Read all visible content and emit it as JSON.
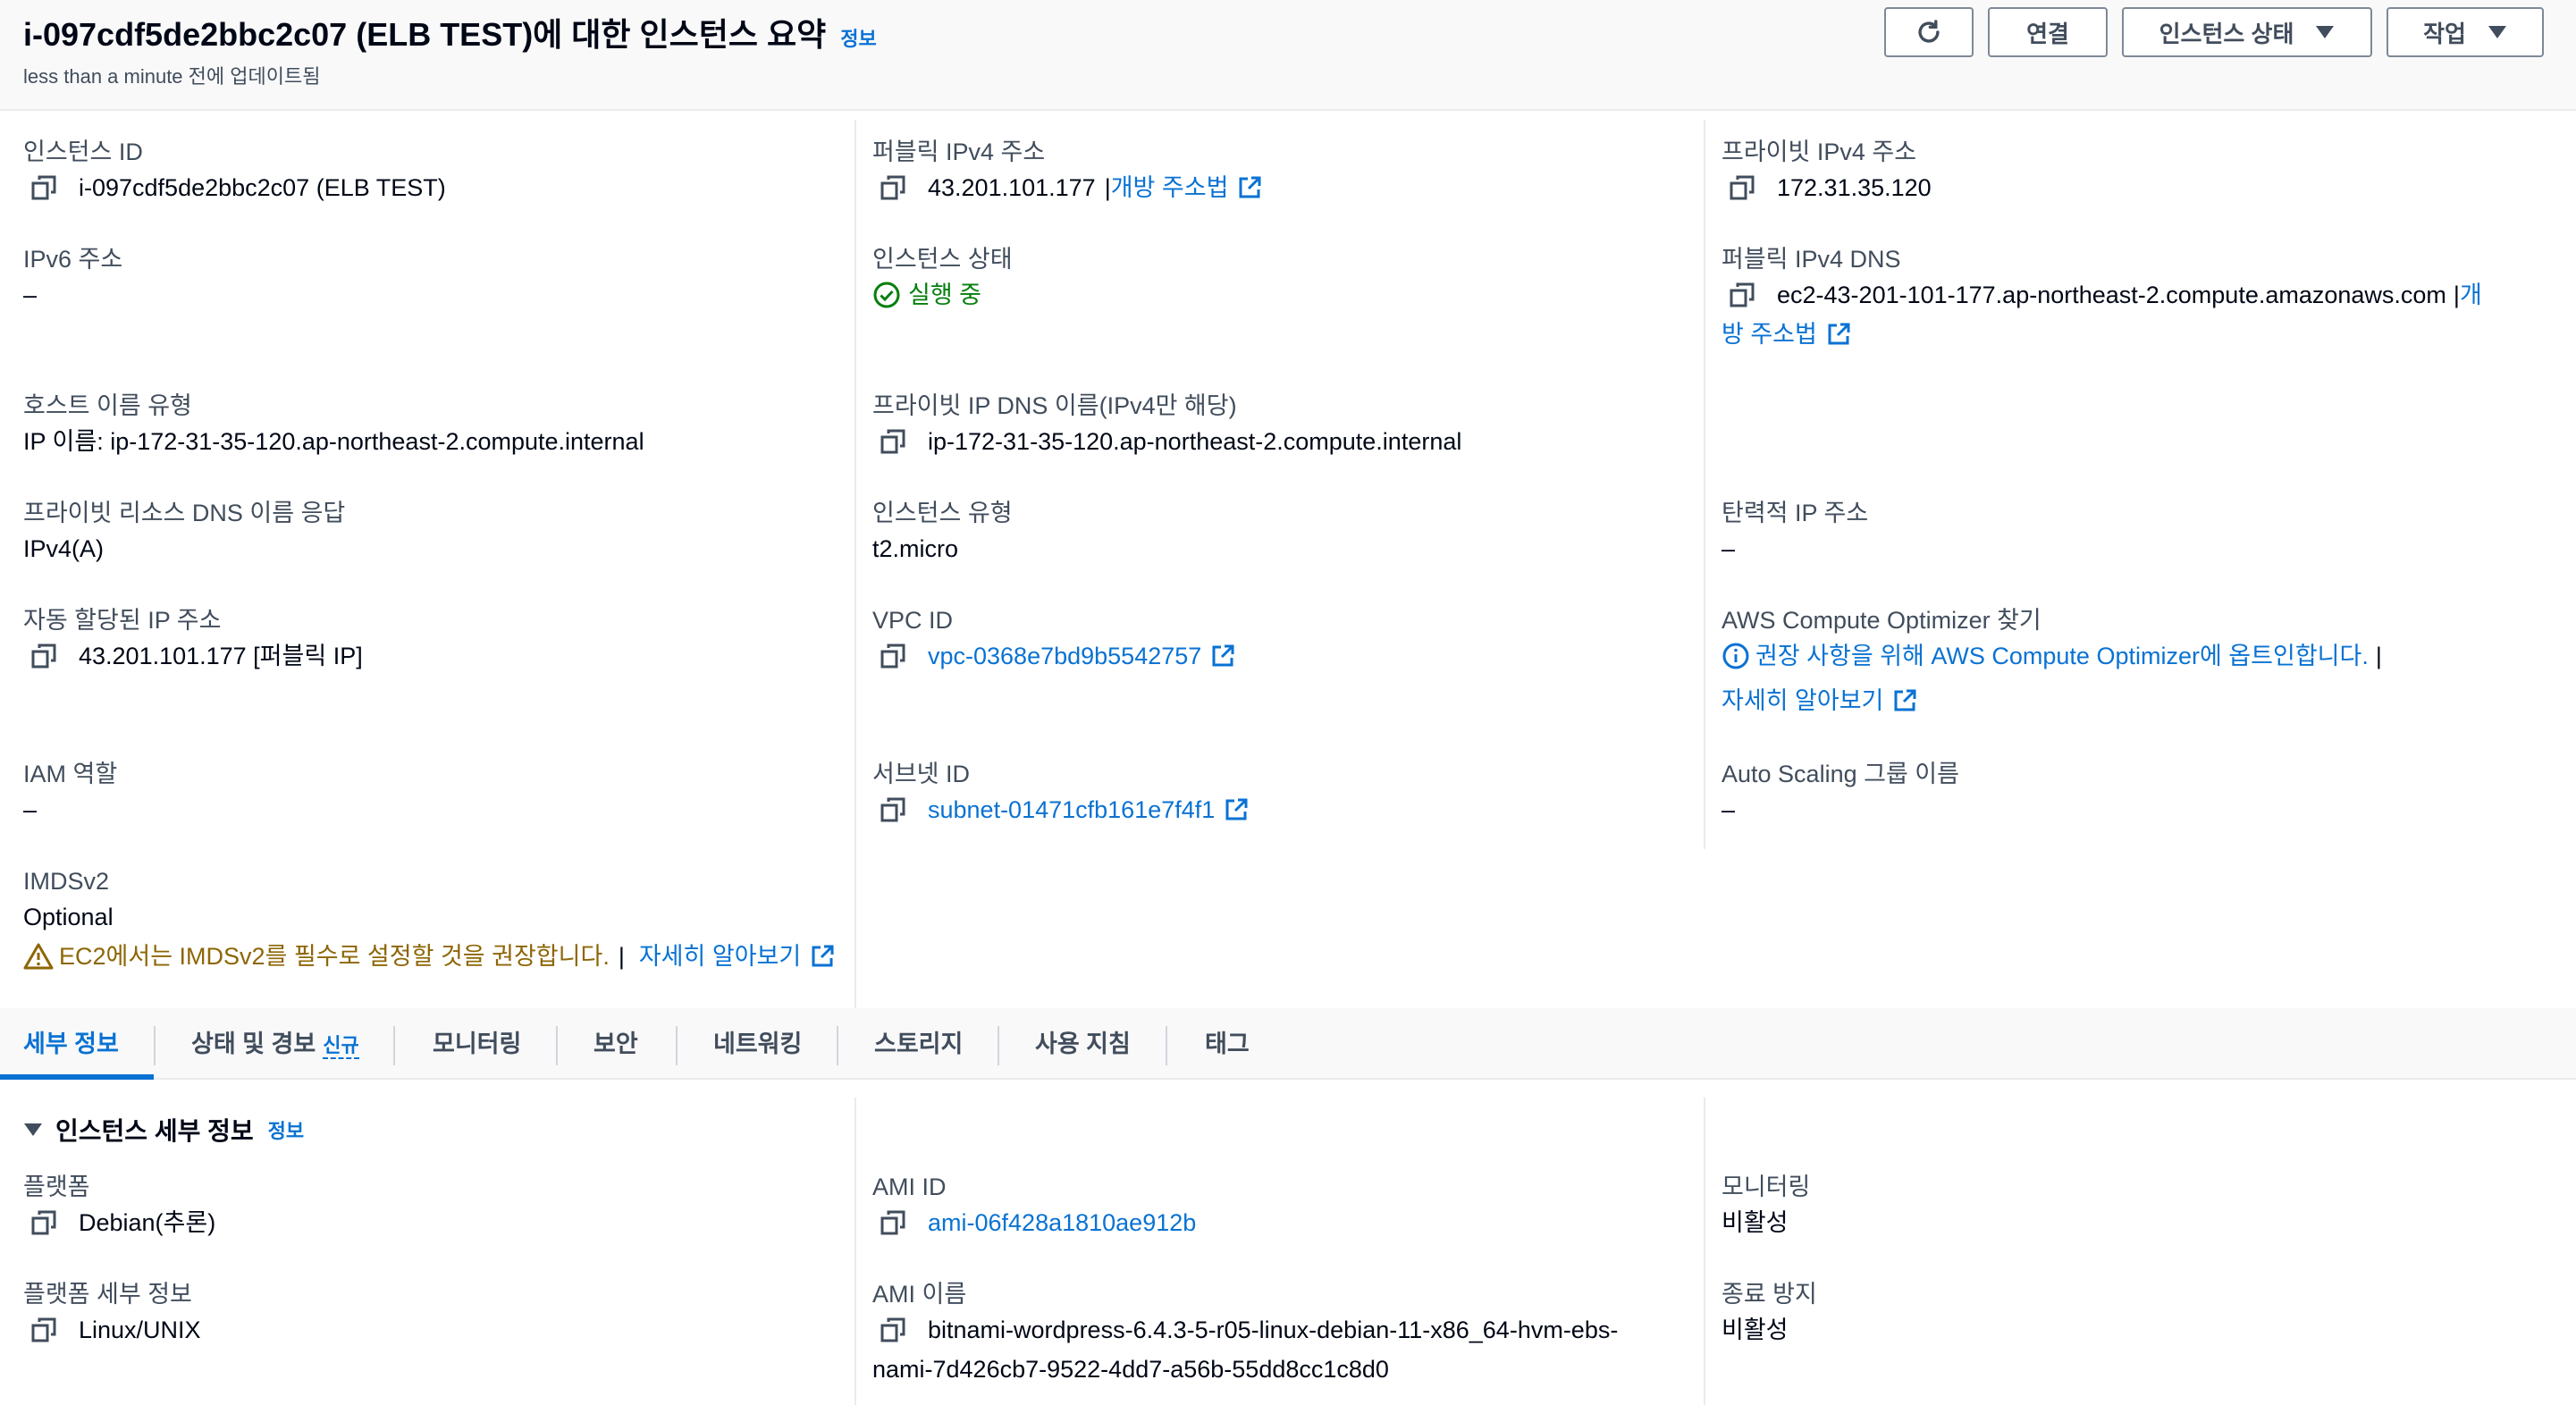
{
  "header": {
    "title": "i-097cdf5de2bbc2c07 (ELB TEST)에 대한 인스턴스 요약",
    "info_label": "정보",
    "subtitle": "less than a minute 전에 업데이트됨",
    "buttons": {
      "refresh_icon": "refresh-icon",
      "connect": "연결",
      "instance_state": "인스턴스 상태",
      "actions": "작업"
    }
  },
  "summary": {
    "instance_id": {
      "label": "인스턴스 ID",
      "value": "i-097cdf5de2bbc2c07 (ELB TEST)"
    },
    "ipv6": {
      "label": "IPv6 주소",
      "value": "–"
    },
    "hostname_type": {
      "label": "호스트 이름 유형",
      "value": "IP 이름: ip-172-31-35-120.ap-northeast-2.compute.internal"
    },
    "private_dns_answer": {
      "label": "프라이빗 리소스 DNS 이름 응답",
      "value": "IPv4(A)"
    },
    "auto_ip": {
      "label": "자동 할당된 IP 주소",
      "value": "43.201.101.177 [퍼블릭 IP]"
    },
    "iam_role": {
      "label": "IAM 역할",
      "value": "–"
    },
    "imdsv2": {
      "label": "IMDSv2",
      "value": "Optional",
      "warning": "EC2에서는 IMDSv2를 필수로 설정할 것을 권장합니다.",
      "separator": "|",
      "learn_more": "자세히 알아보기"
    },
    "public_ipv4": {
      "label": "퍼블릭 IPv4 주소",
      "value": "43.201.101.177",
      "separator": "|",
      "link": "개방 주소법"
    },
    "instance_state": {
      "label": "인스턴스 상태",
      "value": "실행 중"
    },
    "private_ip_dns": {
      "label": "프라이빗 IP DNS 이름(IPv4만 해당)",
      "value": "ip-172-31-35-120.ap-northeast-2.compute.internal"
    },
    "instance_type": {
      "label": "인스턴스 유형",
      "value": "t2.micro"
    },
    "vpc_id": {
      "label": "VPC ID",
      "value": "vpc-0368e7bd9b5542757"
    },
    "subnet_id": {
      "label": "서브넷 ID",
      "value": "subnet-01471cfb161e7f4f1"
    },
    "private_ipv4": {
      "label": "프라이빗 IPv4 주소",
      "value": "172.31.35.120"
    },
    "public_dns": {
      "label": "퍼블릭 IPv4 DNS",
      "value": "ec2-43-201-101-177.ap-northeast-2.compute.amazonaws.com",
      "separator": "|",
      "link_part1": "개",
      "link_part2": "방 주소법"
    },
    "elastic_ip": {
      "label": "탄력적 IP 주소",
      "value": "–"
    },
    "compute_optimizer": {
      "label": "AWS Compute Optimizer 찾기",
      "value": "권장 사항을 위해 AWS Compute Optimizer에 옵트인합니다.",
      "separator": "|",
      "learn_more": "자세히 알아보기"
    },
    "asg_name": {
      "label": "Auto Scaling 그룹 이름",
      "value": "–"
    }
  },
  "tabs": [
    {
      "label": "세부 정보",
      "active": true
    },
    {
      "label": "상태 및 경보",
      "badge": "신규"
    },
    {
      "label": "모니터링"
    },
    {
      "label": "보안"
    },
    {
      "label": "네트워킹"
    },
    {
      "label": "스토리지"
    },
    {
      "label": "사용 지침"
    },
    {
      "label": "태그"
    }
  ],
  "details_section": {
    "title": "인스턴스 세부 정보",
    "info_label": "정보",
    "platform": {
      "label": "플랫폼",
      "value": "Debian(추론)"
    },
    "platform_details": {
      "label": "플랫폼 세부 정보",
      "value": "Linux/UNIX"
    },
    "ami_id": {
      "label": "AMI ID",
      "value": "ami-06f428a1810ae912b"
    },
    "ami_name": {
      "label": "AMI 이름",
      "value_line1": "bitnami-wordpress-6.4.3-5-r05-linux-debian-11-x86_64-hvm-ebs-",
      "value_line2": "nami-7d426cb7-9522-4dd7-a56b-55dd8cc1c8d0"
    },
    "monitoring": {
      "label": "모니터링",
      "value": "비활성"
    },
    "termination_protection": {
      "label": "종료 방지",
      "value": "비활성"
    }
  },
  "colors": {
    "link": "#0972d3",
    "success": "#037f0c",
    "warning": "#8d6605",
    "text": "#000716",
    "label": "#414d5c"
  }
}
